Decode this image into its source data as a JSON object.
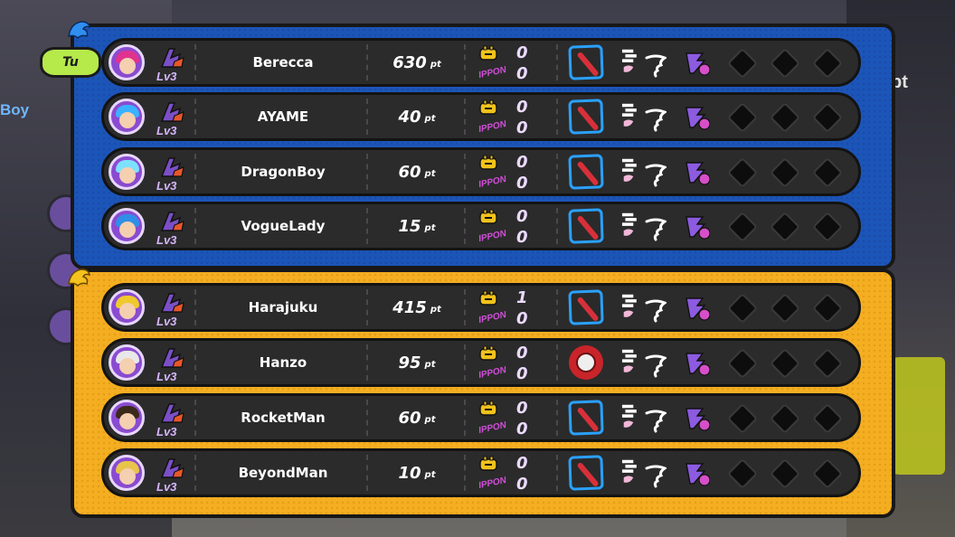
{
  "background": {
    "partial_name": "Boy",
    "partial_pt": "pt"
  },
  "current_player_badge": "Tu",
  "colors": {
    "team_blue": "#1c55b8",
    "team_yellow": "#f4ae21",
    "row_bg": "#2b2b2b",
    "ippon_color": "#d04fd8",
    "level_color": "#d7b7ff",
    "weapon_border": "#2aa1ff"
  },
  "teams": [
    {
      "icon": "blue-dragon-icon",
      "players": [
        {
          "name": "Berecca",
          "level": "Lv3",
          "points": "630",
          "points_unit": "pt",
          "wins": "0",
          "ippon_label": "IPPON",
          "ippon": "0",
          "weapon": "bat-weapon-icon",
          "avatar_hair": "#e0328f"
        },
        {
          "name": "AYAME",
          "level": "Lv3",
          "points": "40",
          "points_unit": "pt",
          "wins": "0",
          "ippon_label": "IPPON",
          "ippon": "0",
          "weapon": "bat-weapon-icon",
          "avatar_hair": "#3ab2ff"
        },
        {
          "name": "DragonBoy",
          "level": "Lv3",
          "points": "60",
          "points_unit": "pt",
          "wins": "0",
          "ippon_label": "IPPON",
          "ippon": "0",
          "weapon": "bat-weapon-icon",
          "avatar_hair": "#7ee0ff"
        },
        {
          "name": "VogueLady",
          "level": "Lv3",
          "points": "15",
          "points_unit": "pt",
          "wins": "0",
          "ippon_label": "IPPON",
          "ippon": "0",
          "weapon": "bat-weapon-icon",
          "avatar_hair": "#2f8fe8"
        }
      ]
    },
    {
      "icon": "yellow-dragon-icon",
      "players": [
        {
          "name": "Harajuku",
          "level": "Lv3",
          "points": "415",
          "points_unit": "pt",
          "wins": "1",
          "ippon_label": "IPPON",
          "ippon": "0",
          "weapon": "bat-weapon-icon",
          "avatar_hair": "#f0c92c"
        },
        {
          "name": "Hanzo",
          "level": "Lv3",
          "points": "95",
          "points_unit": "pt",
          "wins": "0",
          "ippon_label": "IPPON",
          "ippon": "0",
          "weapon": "yoyo-weapon-icon",
          "avatar_hair": "#e8e8e8"
        },
        {
          "name": "RocketMan",
          "level": "Lv3",
          "points": "60",
          "points_unit": "pt",
          "wins": "0",
          "ippon_label": "IPPON",
          "ippon": "0",
          "weapon": "bat-weapon-icon",
          "avatar_hair": "#3a2a1a"
        },
        {
          "name": "BeyondMan",
          "level": "Lv3",
          "points": "10",
          "points_unit": "pt",
          "wins": "0",
          "ippon_label": "IPPON",
          "ippon": "0",
          "weapon": "bat-weapon-icon",
          "avatar_hair": "#e8c44a"
        }
      ]
    }
  ]
}
